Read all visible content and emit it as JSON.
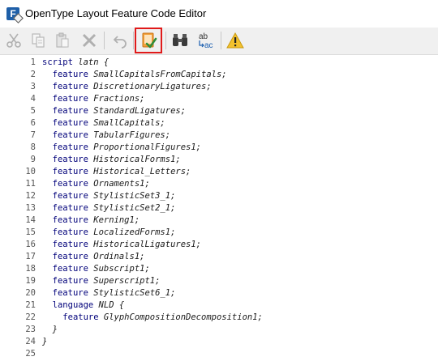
{
  "window": {
    "title": "OpenType Layout Feature Code Editor",
    "app_icon_letter": "F"
  },
  "toolbar": {
    "buttons": [
      {
        "name": "cut",
        "icon": "scissors-icon",
        "enabled": false
      },
      {
        "name": "copy",
        "icon": "copy-icon",
        "enabled": false
      },
      {
        "name": "paste",
        "icon": "paste-icon",
        "enabled": false
      },
      {
        "name": "delete",
        "icon": "delete-x-icon",
        "enabled": false
      },
      {
        "name": "undo",
        "icon": "undo-icon",
        "enabled": false
      },
      {
        "name": "compile",
        "icon": "compile-check-icon",
        "enabled": true,
        "highlighted": true
      },
      {
        "name": "find",
        "icon": "binoculars-icon",
        "enabled": true
      },
      {
        "name": "replace",
        "icon": "replace-abc-icon",
        "enabled": true,
        "label_top": "ab",
        "label_bottom": "ac"
      },
      {
        "name": "warning",
        "icon": "warning-icon",
        "enabled": true
      }
    ],
    "highlight_color": "#e01a1a"
  },
  "editor": {
    "lines": [
      {
        "n": "1",
        "kw": "script",
        "rest": " latn {"
      },
      {
        "n": "2",
        "indent": "  ",
        "kw": "feature",
        "rest": " SmallCapitalsFromCapitals;"
      },
      {
        "n": "3",
        "indent": "  ",
        "kw": "feature",
        "rest": " DiscretionaryLigatures;"
      },
      {
        "n": "4",
        "indent": "  ",
        "kw": "feature",
        "rest": " Fractions;"
      },
      {
        "n": "5",
        "indent": "  ",
        "kw": "feature",
        "rest": " StandardLigatures;"
      },
      {
        "n": "6",
        "indent": "  ",
        "kw": "feature",
        "rest": " SmallCapitals;"
      },
      {
        "n": "7",
        "indent": "  ",
        "kw": "feature",
        "rest": " TabularFigures;"
      },
      {
        "n": "8",
        "indent": "  ",
        "kw": "feature",
        "rest": " ProportionalFigures1;"
      },
      {
        "n": "9",
        "indent": "  ",
        "kw": "feature",
        "rest": " HistoricalForms1;"
      },
      {
        "n": "10",
        "indent": "  ",
        "kw": "feature",
        "rest": " Historical_Letters;"
      },
      {
        "n": "11",
        "indent": "  ",
        "kw": "feature",
        "rest": " Ornaments1;"
      },
      {
        "n": "12",
        "indent": "  ",
        "kw": "feature",
        "rest": " StylisticSet3_1;"
      },
      {
        "n": "13",
        "indent": "  ",
        "kw": "feature",
        "rest": " StylisticSet2_1;"
      },
      {
        "n": "14",
        "indent": "  ",
        "kw": "feature",
        "rest": " Kerning1;"
      },
      {
        "n": "15",
        "indent": "  ",
        "kw": "feature",
        "rest": " LocalizedForms1;"
      },
      {
        "n": "16",
        "indent": "  ",
        "kw": "feature",
        "rest": " HistoricalLigatures1;"
      },
      {
        "n": "17",
        "indent": "  ",
        "kw": "feature",
        "rest": " Ordinals1;"
      },
      {
        "n": "18",
        "indent": "  ",
        "kw": "feature",
        "rest": " Subscript1;"
      },
      {
        "n": "19",
        "indent": "  ",
        "kw": "feature",
        "rest": " Superscript1;"
      },
      {
        "n": "20",
        "indent": "  ",
        "kw": "feature",
        "rest": " StylisticSet6_1;"
      },
      {
        "n": "21",
        "indent": "  ",
        "kw": "language",
        "rest": " NLD {"
      },
      {
        "n": "22",
        "indent": "    ",
        "kw": "feature",
        "rest": " GlyphCompositionDecomposition1;"
      },
      {
        "n": "23",
        "indent": "  ",
        "kw": "",
        "rest": "}"
      },
      {
        "n": "24",
        "kw": "",
        "rest": "}"
      },
      {
        "n": "25",
        "kw": "",
        "rest": ""
      }
    ]
  }
}
